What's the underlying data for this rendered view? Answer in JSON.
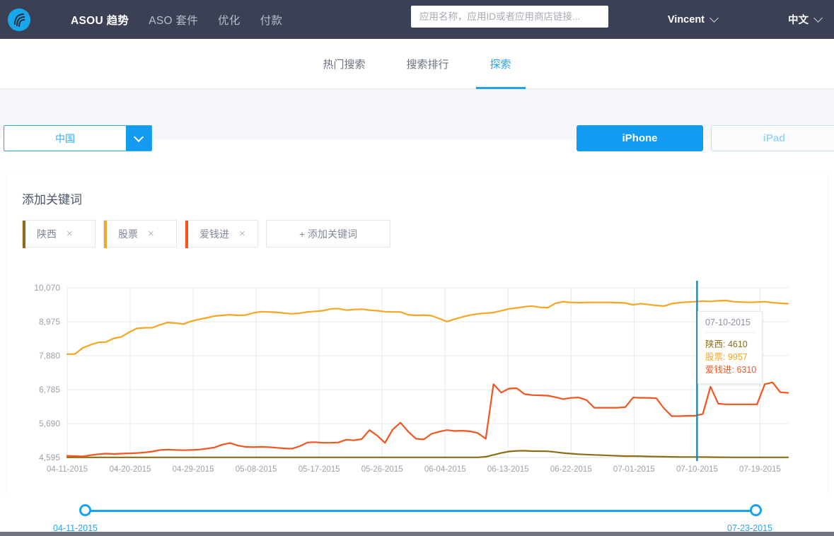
{
  "header": {
    "logo_icon": "asou-logo-icon",
    "nav_links": [
      {
        "label": "ASOU 趋势",
        "active": true
      },
      {
        "label": "ASO 套件",
        "active": false
      },
      {
        "label": "优化",
        "active": false
      },
      {
        "label": "付款",
        "active": false
      }
    ],
    "search": {
      "placeholder": "应用名称，应用ID或者应用商店链接...",
      "value": ""
    },
    "user": "Vincent",
    "language": "中文"
  },
  "subnav": {
    "tabs": [
      {
        "label": "热门搜索",
        "active": false
      },
      {
        "label": "搜索排行",
        "active": false
      },
      {
        "label": "探索",
        "active": true
      }
    ]
  },
  "filters": {
    "country": "中国",
    "devices": [
      {
        "label": "iPhone",
        "active": true
      },
      {
        "label": "iPad",
        "active": false
      }
    ]
  },
  "keywords_panel": {
    "title": "添加关键词",
    "chips": [
      {
        "label": "陕西",
        "color": "#8a6d16",
        "close": "×"
      },
      {
        "label": "股票",
        "color": "#f5a623",
        "close": "×"
      },
      {
        "label": "爱钱进",
        "color": "#f4541d",
        "close": "×"
      }
    ],
    "add_label": "+ 添加关键词"
  },
  "tooltip": {
    "date": "07-10-2015",
    "rows": [
      {
        "label": "陕西: 4610",
        "color": "#8a6d16"
      },
      {
        "label": "股票: 9957",
        "color": "#f5a623"
      },
      {
        "label": "爱钱进: 6310",
        "color": "#f4541d"
      }
    ]
  },
  "range_slider": {
    "start": "04-11-2015",
    "end": "07-23-2015"
  },
  "chart_data": {
    "type": "line",
    "title": "",
    "xlabel": "",
    "ylabel": "",
    "grid": true,
    "legend_position": "none",
    "ylim": [
      4595,
      10070
    ],
    "yticks": [
      "10,070",
      "8,975",
      "7,880",
      "6,785",
      "5,690",
      "4,595"
    ],
    "ytick_values": [
      10070,
      8975,
      7880,
      6785,
      5690,
      4595
    ],
    "xticks": [
      "04-11-2015",
      "04-20-2015",
      "04-29-2015",
      "05-08-2015",
      "05-17-2015",
      "05-26-2015",
      "06-04-2015",
      "06-13-2015",
      "06-22-2015",
      "07-01-2015",
      "07-10-2015",
      "07-19-2015"
    ],
    "x_start": "04-11-2015",
    "x_end": "07-23-2015",
    "crosshair_date": "07-10-2015",
    "series": [
      {
        "name": "陕西",
        "color": "#8a6d16",
        "values": [
          4600,
          4600,
          4600,
          4600,
          4600,
          4600,
          4600,
          4600,
          4600,
          4600,
          4600,
          4600,
          4600,
          4600,
          4600,
          4600,
          4600,
          4600,
          4600,
          4600,
          4600,
          4600,
          4600,
          4600,
          4600,
          4600,
          4600,
          4600,
          4600,
          4600,
          4600,
          4600,
          4600,
          4600,
          4600,
          4600,
          4600,
          4600,
          4600,
          4600,
          4600,
          4600,
          4600,
          4600,
          4600,
          4600,
          4600,
          4600,
          4600,
          4600,
          4600,
          4600,
          4600,
          4600,
          4620,
          4680,
          4740,
          4790,
          4810,
          4815,
          4800,
          4800,
          4795,
          4770,
          4740,
          4720,
          4700,
          4690,
          4680,
          4670,
          4660,
          4650,
          4640,
          4640,
          4635,
          4630,
          4625,
          4620,
          4615,
          4612,
          4610,
          4610,
          4608,
          4606,
          4604,
          4602,
          4600,
          4600,
          4600,
          4600,
          4600,
          4600,
          4600,
          4600
        ]
      },
      {
        "name": "股票",
        "color": "#f5a623",
        "values": [
          7930,
          7935,
          8130,
          8230,
          8310,
          8320,
          8440,
          8490,
          8640,
          8760,
          8780,
          8780,
          8880,
          8950,
          8930,
          8900,
          8990,
          9050,
          9100,
          9160,
          9180,
          9200,
          9180,
          9190,
          9260,
          9300,
          9290,
          9280,
          9250,
          9230,
          9250,
          9290,
          9310,
          9330,
          9390,
          9400,
          9350,
          9370,
          9380,
          9350,
          9330,
          9300,
          9290,
          9290,
          9200,
          9180,
          9190,
          9170,
          9080,
          8980,
          9060,
          9130,
          9190,
          9230,
          9250,
          9270,
          9330,
          9390,
          9420,
          9460,
          9480,
          9440,
          9430,
          9570,
          9620,
          9600,
          9590,
          9600,
          9600,
          9600,
          9600,
          9590,
          9580,
          9520,
          9560,
          9530,
          9500,
          9480,
          9560,
          9590,
          9610,
          9620,
          9640,
          9630,
          9650,
          9660,
          9620,
          9610,
          9600,
          9610,
          9620,
          9590,
          9570,
          9560
        ]
      },
      {
        "name": "爱钱进",
        "color": "#f4541d",
        "values": [
          4650,
          4640,
          4630,
          4670,
          4700,
          4720,
          4710,
          4720,
          4730,
          4740,
          4760,
          4790,
          4840,
          4850,
          4840,
          4830,
          4840,
          4850,
          4880,
          4920,
          5010,
          5060,
          4980,
          4940,
          4930,
          4940,
          4930,
          4910,
          4890,
          4880,
          4960,
          5080,
          5090,
          5070,
          5070,
          5080,
          5170,
          5150,
          5190,
          5480,
          5300,
          5070,
          5500,
          5720,
          5430,
          5200,
          5180,
          5360,
          5430,
          5480,
          5450,
          5460,
          5440,
          5380,
          5200,
          6960,
          6690,
          6820,
          6830,
          6640,
          6610,
          6600,
          6590,
          6540,
          6480,
          6520,
          6530,
          6450,
          6200,
          6200,
          6200,
          6200,
          6220,
          6530,
          6520,
          6520,
          6510,
          6180,
          5930,
          5930,
          5940,
          5940,
          6000,
          6880,
          6330,
          6310,
          6310,
          6310,
          6310,
          6310,
          6960,
          7020,
          6700,
          6680
        ]
      }
    ]
  }
}
